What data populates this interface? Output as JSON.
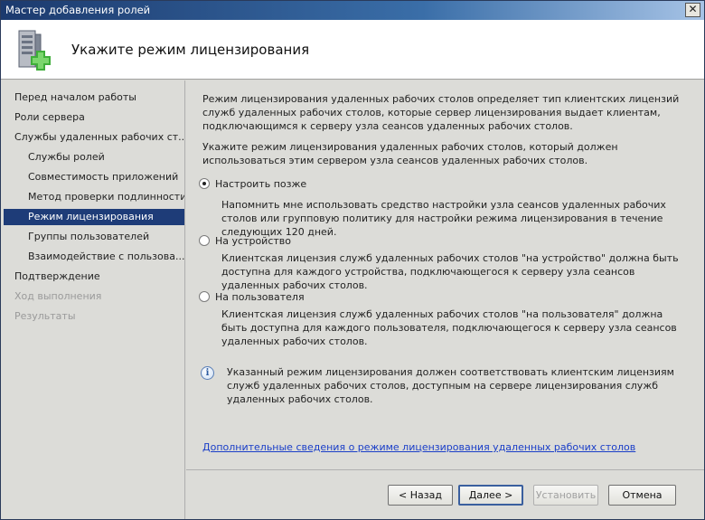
{
  "window": {
    "title": "Мастер добавления ролей",
    "close_label": "✕"
  },
  "header": {
    "title": "Укажите режим лицензирования",
    "icon": "server-add-icon"
  },
  "sidebar": {
    "items": [
      {
        "label": "Перед началом работы",
        "state": "normal"
      },
      {
        "label": "Роли сервера",
        "state": "normal"
      },
      {
        "label": "Службы удаленных рабочих ст...",
        "state": "normal"
      },
      {
        "label": "Службы ролей",
        "state": "normal"
      },
      {
        "label": "Совместимость приложений",
        "state": "normal"
      },
      {
        "label": "Метод проверки подлинности",
        "state": "normal"
      },
      {
        "label": "Режим лицензирования",
        "state": "selected"
      },
      {
        "label": "Группы пользователей",
        "state": "normal"
      },
      {
        "label": "Взаимодействие с пользова...",
        "state": "normal"
      },
      {
        "label": "Подтверждение",
        "state": "normal"
      },
      {
        "label": "Ход выполнения",
        "state": "disabled"
      },
      {
        "label": "Результаты",
        "state": "disabled"
      }
    ]
  },
  "main": {
    "intro": "Режим лицензирования удаленных рабочих столов определяет тип клиентских лицензий служб удаленных рабочих столов, которые сервер лицензирования выдает клиентам, подключающимся к серверу узла сеансов удаленных рабочих столов.",
    "prompt": "Укажите режим лицензирования удаленных рабочих столов, который должен использоваться этим сервером узла сеансов удаленных рабочих столов.",
    "options": [
      {
        "label": "Настроить позже",
        "checked": true,
        "description": "Напомнить мне использовать средство настройки узла сеансов удаленных рабочих столов или групповую политику для настройки режима лицензирования в течение следующих 120 дней."
      },
      {
        "label": "На устройство",
        "checked": false,
        "description": "Клиентская лицензия служб удаленных рабочих столов \"на устройство\" должна быть доступна для каждого устройства, подключающегося к серверу узла сеансов удаленных рабочих столов."
      },
      {
        "label": "На пользователя",
        "checked": false,
        "description": "Клиентская лицензия служб удаленных рабочих столов \"на пользователя\" должна быть доступна для каждого пользователя, подключающегося к серверу узла сеансов удаленных рабочих столов."
      }
    ],
    "info_text": "Указанный режим лицензирования должен соответствовать клиентским лицензиям служб удаленных рабочих столов, доступным на сервере лицензирования служб удаленных рабочих столов.",
    "info_icon": "info-icon",
    "link_text": "Дополнительные сведения о режиме лицензирования удаленных рабочих столов"
  },
  "footer": {
    "back_label": "< Назад",
    "next_label": "Далее >",
    "install_label": "Установить",
    "cancel_label": "Отмена"
  },
  "colors": {
    "selected_bg": "#1e3c78",
    "link": "#1a3ec8",
    "titlebar": "#1c3a6e"
  }
}
